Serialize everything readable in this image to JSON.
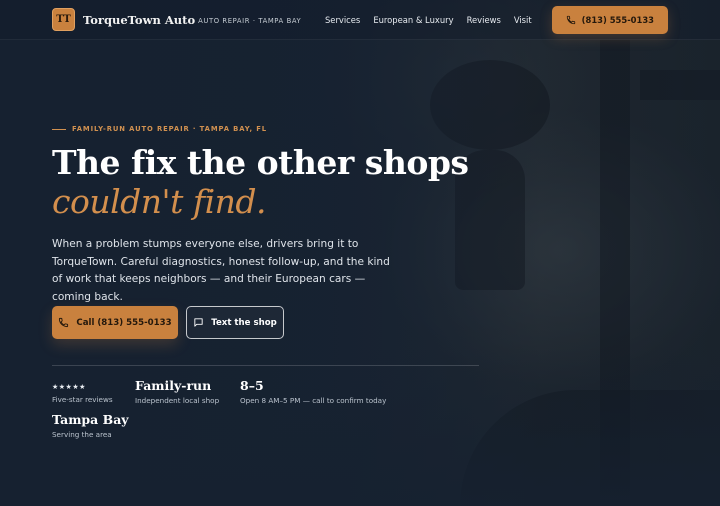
{
  "header": {
    "logo_initials": "TT",
    "brand_name": "TorqueTown Auto",
    "brand_tagline": "AUTO REPAIR · TAMPA BAY",
    "nav": [
      "Services",
      "European & Luxury",
      "Reviews",
      "Visit"
    ],
    "call_label": "(813) 555-0133"
  },
  "hero": {
    "eyebrow": "FAMILY-RUN AUTO REPAIR · TAMPA BAY, FL",
    "headline": "The fix the other shops",
    "headline_accent": "couldn't find.",
    "lede": "When a problem stumps everyone else, drivers bring it to TorqueTown. Careful diagnostics, honest follow-up, and the kind of work that keeps neighbors — and their European cars — coming back.",
    "primary_button": "Call (813) 555-0133",
    "secondary_button": "Text the shop"
  },
  "stats": [
    {
      "title": "★★★★★",
      "sub": "Five-star reviews"
    },
    {
      "title": "Family-run",
      "sub": "Independent local shop"
    },
    {
      "title": "8–5",
      "sub": "Open 8 AM–5 PM — call to confirm today"
    },
    {
      "title": "Tampa Bay",
      "sub": "Serving the area"
    }
  ],
  "colors": {
    "accent": "#c9813e",
    "background": "#16202c",
    "headline_accent": "#d38f4d"
  },
  "icons": {
    "phone": "phone-icon",
    "message": "message-icon"
  }
}
